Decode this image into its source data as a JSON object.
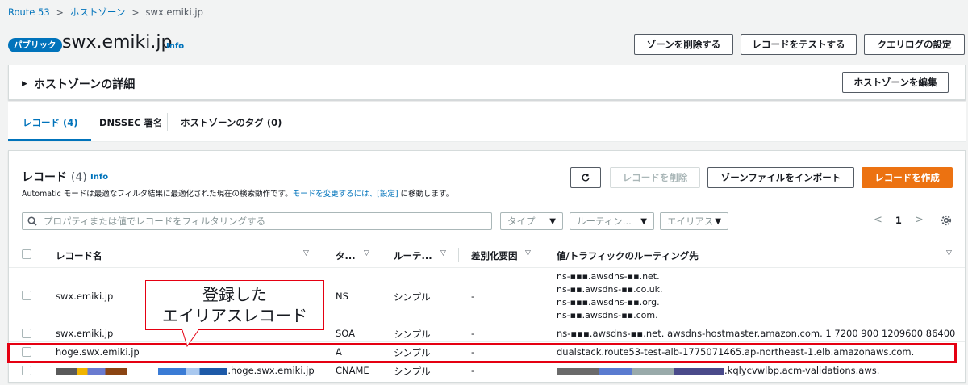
{
  "breadcrumb": {
    "root": "Route 53",
    "parent": "ホストゾーン",
    "current": "swx.emiki.jp"
  },
  "header": {
    "badge": "パブリック",
    "title": "swx.emiki.jp",
    "info": "Info",
    "buttons": {
      "delete_zone": "ゾーンを削除する",
      "test_record": "レコードをテストする",
      "query_log": "クエリログの設定"
    }
  },
  "details": {
    "title": "ホストゾーンの詳細",
    "edit_button": "ホストゾーンを編集"
  },
  "tabs": [
    {
      "label": "レコード (4)"
    },
    {
      "label": "DNSSEC 署名"
    },
    {
      "label": "ホストゾーンのタグ (0)"
    }
  ],
  "records": {
    "title": "レコード",
    "count": "(4)",
    "info": "Info",
    "desc_prefix": "Automatic モードは最適なフィルタ結果に最適化された現在の検索動作です。",
    "desc_link1": "モードを変更するには、[設定]",
    "desc_suffix": " に移動します。",
    "buttons": {
      "delete": "レコードを削除",
      "import": "ゾーンファイルをインポート",
      "create": "レコードを作成"
    },
    "search_placeholder": "プロパティまたは値でレコードをフィルタリングする",
    "filters": {
      "type": "タイプ",
      "routing": "ルーティン...",
      "alias": "エイリアス"
    },
    "page": "1",
    "columns": {
      "name": "レコード名",
      "type": "タ...",
      "routing": "ルーテ...",
      "diff": "差別化要因",
      "value": "値/トラフィックのルーティング先"
    },
    "rows": [
      {
        "name": "swx.emiki.jp",
        "type": "NS",
        "routing": "シンプル",
        "diff": "-",
        "values": [
          "ns-▪▪▪.awsdns-▪▪.net.",
          "ns-▪▪.awsdns-▪▪.co.uk.",
          "ns-▪▪▪.awsdns-▪▪.org.",
          "ns-▪▪.awsdns-▪▪.com."
        ]
      },
      {
        "name": "swx.emiki.jp",
        "type": "SOA",
        "routing": "シンプル",
        "diff": "-",
        "value": "ns-▪▪▪.awsdns-▪▪.net. awsdns-hostmaster.amazon.com. 1 7200 900 1209600 86400"
      },
      {
        "name": "hoge.swx.emiki.jp",
        "type": "A",
        "routing": "シンプル",
        "diff": "-",
        "value": "dualstack.route53-test-alb-1775071465.ap-northeast-1.elb.amazonaws.com."
      },
      {
        "name": ".hoge.swx.emiki.jp",
        "type": "CNAME",
        "routing": "シンプル",
        "diff": "-",
        "value": ".kqlycvwlbp.acm-validations.aws."
      }
    ]
  },
  "annotation": {
    "line1": "登録した",
    "line2": "エイリアスレコード"
  },
  "colors": {
    "link": "#0073bb",
    "primary": "#ec7211",
    "highlight": "#e50012"
  }
}
